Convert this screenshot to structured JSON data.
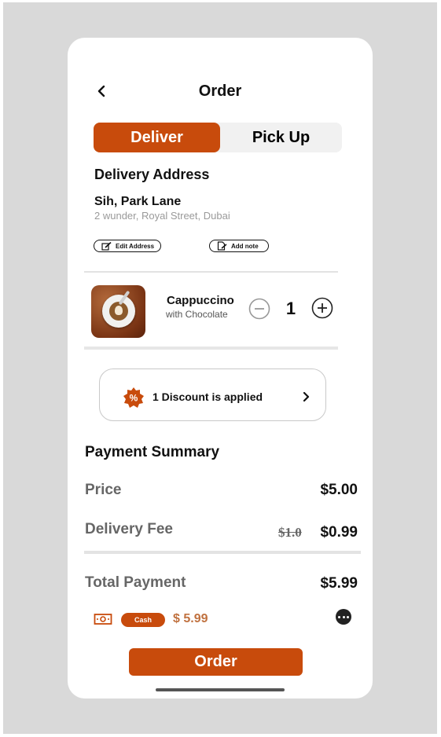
{
  "header": {
    "title": "Order"
  },
  "mode_toggle": {
    "deliver_label": "Deliver",
    "pickup_label": "Pick Up",
    "selected": "Deliver"
  },
  "address": {
    "heading": "Delivery Address",
    "name": "Sih, Park Lane",
    "line": "2 wunder, Royal Street, Dubai",
    "edit_label": "Edit Address",
    "note_label": "Add note"
  },
  "product": {
    "name": "Cappuccino",
    "subtitle": "with Chocolate",
    "quantity": "1"
  },
  "discount": {
    "text": "1 Discount is applied",
    "badge": "%"
  },
  "payment": {
    "heading": "Payment Summary",
    "price_label": "Price",
    "price_value": "$5.00",
    "fee_label": "Delivery Fee",
    "fee_old": "$1.0",
    "fee_value": "$0.99",
    "total_label": "Total Payment",
    "total_value": "$5.99",
    "method_label": "Cash",
    "method_amount": "$ 5.99"
  },
  "actions": {
    "order_label": "Order"
  },
  "colors": {
    "accent": "#c84b0c",
    "muted": "#9a9a9a",
    "amount": "#c0713f"
  }
}
